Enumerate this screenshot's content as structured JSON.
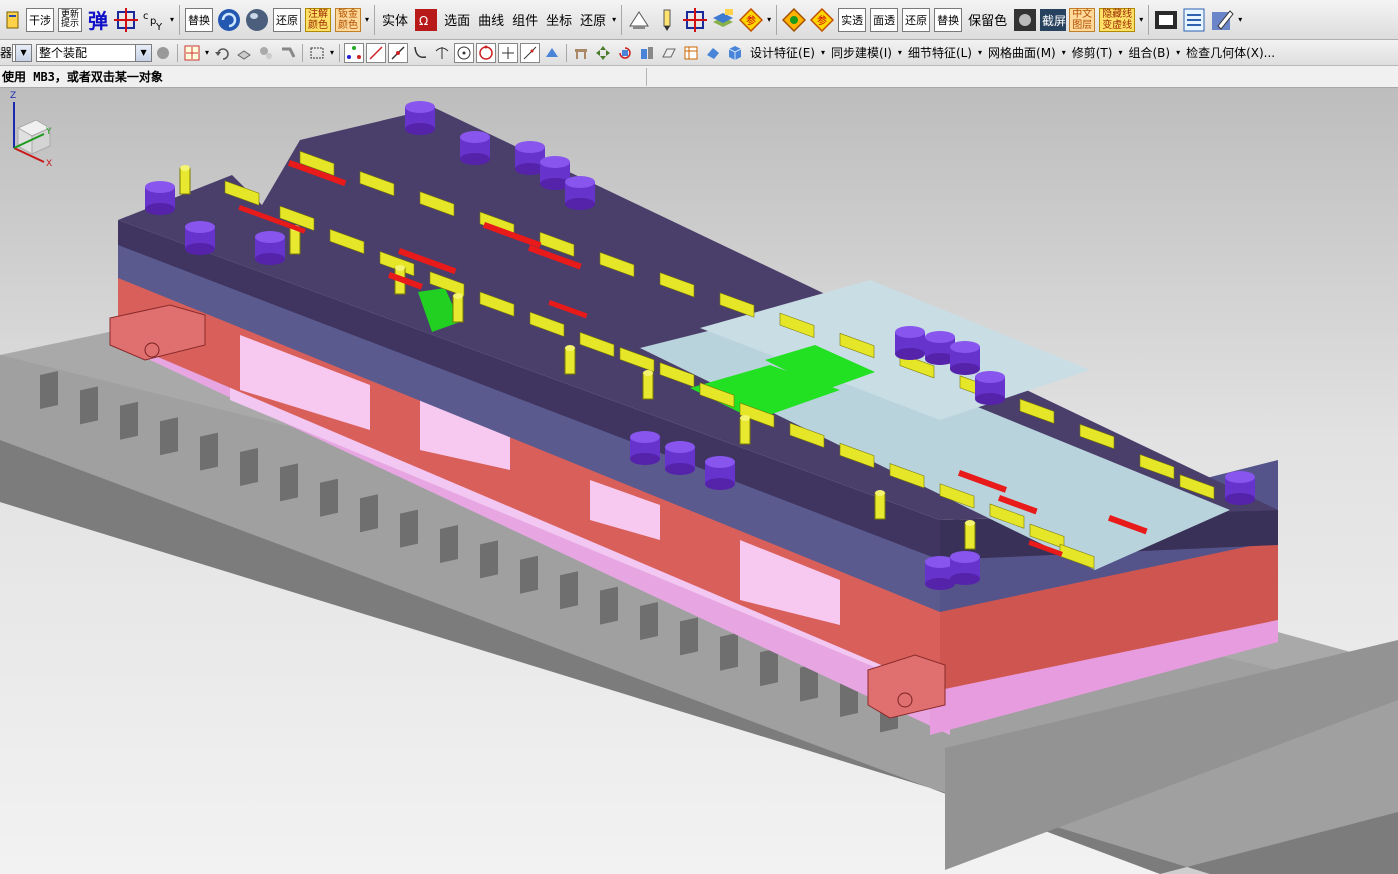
{
  "toolbar_top": {
    "items": [
      {
        "type": "boxtext",
        "label": "干涉",
        "name": "interference-button"
      },
      {
        "type": "boxtext",
        "label": "更新\n提示",
        "name": "update-hint-button"
      },
      {
        "type": "big",
        "label": "弹",
        "name": "spring-button",
        "color": "#1010c8"
      },
      {
        "type": "boxtext",
        "label": "替换",
        "name": "replace-button-1"
      },
      {
        "type": "boxtext",
        "label": "还原",
        "name": "restore-button-1"
      },
      {
        "type": "boxtext-yellow",
        "label": "注解\n颜色",
        "name": "annotation-color-button"
      },
      {
        "type": "boxtext-orange",
        "label": "钣金\n颜色",
        "name": "sheetmetal-color-button"
      },
      {
        "type": "text",
        "label": "实体",
        "name": "solid-button"
      },
      {
        "type": "text",
        "label": "选面",
        "name": "select-face-button"
      },
      {
        "type": "text",
        "label": "曲线",
        "name": "curve-button"
      },
      {
        "type": "text",
        "label": "组件",
        "name": "component-button"
      },
      {
        "type": "text",
        "label": "坐标",
        "name": "coordinate-button"
      },
      {
        "type": "text",
        "label": "还原",
        "name": "restore-button-2"
      },
      {
        "type": "boxtext",
        "label": "实透",
        "name": "solid-transparent-button"
      },
      {
        "type": "boxtext",
        "label": "面透",
        "name": "face-transparent-button"
      },
      {
        "type": "boxtext",
        "label": "还原",
        "name": "restore-button-3"
      },
      {
        "type": "boxtext",
        "label": "替换",
        "name": "replace-button-2"
      },
      {
        "type": "text",
        "label": "保留色",
        "name": "keep-color-button"
      },
      {
        "type": "boxtext-orange",
        "label": "中文\n图层",
        "name": "chinese-layer-button"
      },
      {
        "type": "boxtext-yellow",
        "label": "隐藏线\n变虚线",
        "name": "hidden-line-dashed-button"
      }
    ]
  },
  "toolbar_second": {
    "filter_label": "器",
    "assembly_filter": "整个装配",
    "menus": [
      "设计特征(E)",
      "同步建模(I)",
      "细节特征(L)",
      "网格曲面(M)",
      "修剪(T)",
      "组合(B)",
      "检查几何体(X)..."
    ]
  },
  "cue": {
    "text": "使用 MB3，或者双击某一对象"
  },
  "triad": {
    "x_label": "X",
    "y_label": "Y",
    "z_label": "Z"
  },
  "colors": {
    "die_plate_purple": "#4a3f6b",
    "plate_blue": "#5d5a8f",
    "die_shoe_red": "#d95f58",
    "spacer_pink": "#e89ce0",
    "table_gray": "#9a9a9a",
    "part_yellow": "#e6e628",
    "strip_lightblue": "#b9d3dc",
    "accent_green": "#22e022",
    "guide_purple": "#6633cc"
  }
}
